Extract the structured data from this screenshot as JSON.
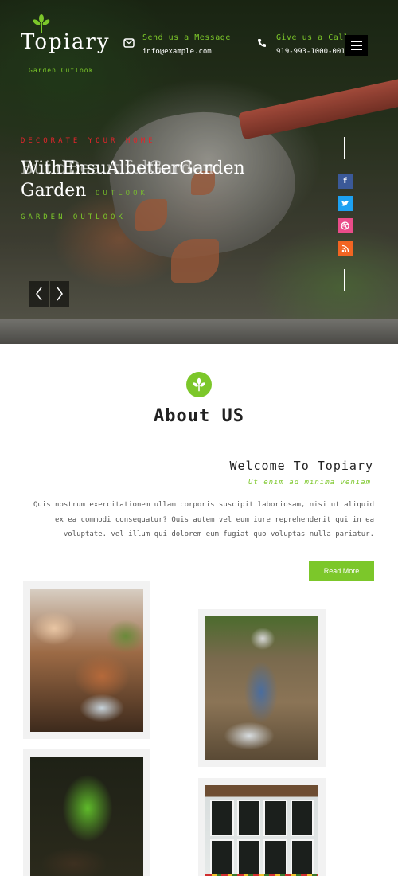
{
  "brand": {
    "name": "Topiary",
    "tagline": "Garden Outlook"
  },
  "header": {
    "contact_email": {
      "label": "Send us a Message",
      "value": "info@example.com",
      "icon": "envelope-icon"
    },
    "contact_phone": {
      "label": "Give us a Call",
      "value": "919-993-1000-001",
      "icon": "phone-icon"
    },
    "menu_icon": "hamburger-icon"
  },
  "hero": {
    "kicker": "DECORATE YOUR HOME",
    "title_ghost": "BuildBeautifulGarden",
    "title_line1": "WithEnsuAlbetterGarden",
    "title_line2": "Garden",
    "tag_ghost": "OUTLOOK",
    "tag": "GARDEN OUTLOOK",
    "prev_icon": "chevron-left-icon",
    "next_icon": "chevron-right-icon",
    "social": [
      {
        "name": "facebook-icon",
        "color": "#3b5998",
        "glyph": "f"
      },
      {
        "name": "twitter-icon",
        "color": "#1da1f2",
        "glyph": "t"
      },
      {
        "name": "dribbble-icon",
        "color": "#ea4c89",
        "glyph": "◎"
      },
      {
        "name": "rss-icon",
        "color": "#f26522",
        "glyph": "≋"
      }
    ]
  },
  "about": {
    "title": "About US",
    "heading": "Welcome To Topiary",
    "subheading": "Ut enim ad minima veniam",
    "body": "Quis nostrum exercitationem ullam corporis suscipit laboriosam, nisi ut aliquid ex ea commodi consequatur? Quis autem vel eum iure reprehenderit qui in ea voluptate. vel illum qui dolorem eum fugiat quo voluptas nulla pariatur.",
    "button": "Read More"
  },
  "colors": {
    "accent": "#7cc72a",
    "kicker_red": "#e2252b"
  }
}
